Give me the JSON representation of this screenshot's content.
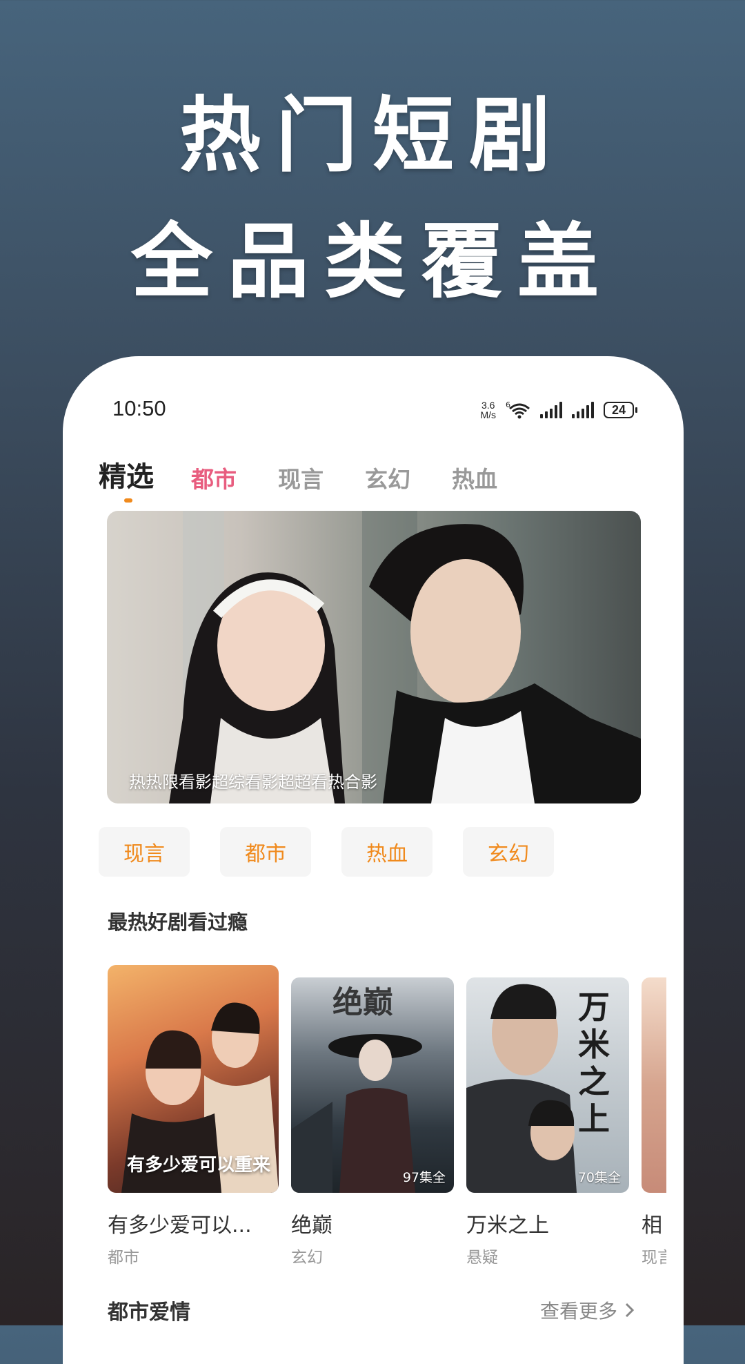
{
  "promo": {
    "line1": "热门短剧",
    "line2": "全品类覆盖"
  },
  "status_bar": {
    "time": "10:50",
    "net_speed_value": "3.6",
    "net_speed_unit": "M/s",
    "wifi_tag": "6",
    "battery": "24"
  },
  "tabs": [
    {
      "label": "精选",
      "selected": true
    },
    {
      "label": "都市"
    },
    {
      "label": "现言"
    },
    {
      "label": "玄幻"
    },
    {
      "label": "热血"
    }
  ],
  "banner": {
    "caption": "热热限看影超综看影超超看热合影"
  },
  "chips": [
    "现言",
    "都市",
    "热血",
    "玄幻"
  ],
  "section_hot": {
    "title": "最热好剧看过瘾"
  },
  "cards": [
    {
      "title": "有多少爱可以...",
      "genre": "都市",
      "poster_text": "有多少爱可以重来",
      "episodes": ""
    },
    {
      "title": "绝巅",
      "genre": "玄幻",
      "poster_text": "绝巅",
      "episodes": "97集全"
    },
    {
      "title": "万米之上",
      "genre": "悬疑",
      "poster_text": "万米之上",
      "episodes": "70集全"
    },
    {
      "title": "相",
      "genre": "现言",
      "poster_text": "",
      "episodes": ""
    }
  ],
  "section_urban": {
    "title": "都市爱情",
    "more_label": "查看更多"
  }
}
